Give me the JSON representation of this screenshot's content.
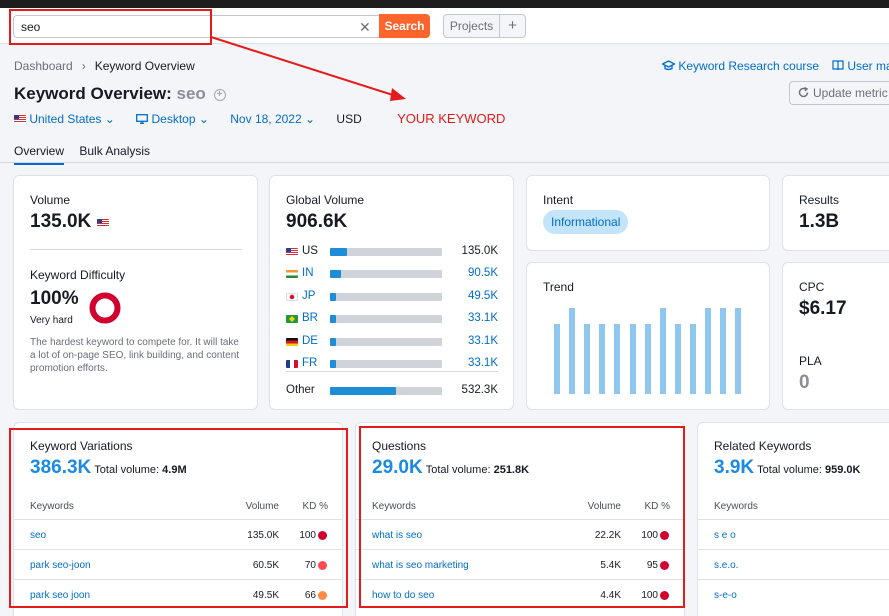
{
  "search": {
    "value": "seo",
    "button_label": "Search",
    "clear_symbol": "✕"
  },
  "header": {
    "projects_label": "Projects",
    "add_symbol": "+"
  },
  "breadcrumb": {
    "home": "Dashboard",
    "separator": "›",
    "current": "Keyword Overview"
  },
  "links": {
    "course": "Keyword Research course",
    "manual": "User ma"
  },
  "title": {
    "prefix": "Keyword Overview:",
    "keyword": "seo",
    "add_symbol": "+"
  },
  "update_button": "Update metric",
  "filters": {
    "country": "United States",
    "device": "Desktop",
    "date": "Nov 18, 2022",
    "currency": "USD",
    "annotation": "YOUR KEYWORD"
  },
  "tabs": [
    "Overview",
    "Bulk Analysis"
  ],
  "volume": {
    "label": "Volume",
    "value": "135.0K"
  },
  "difficulty": {
    "label": "Keyword Difficulty",
    "value": "100%",
    "level": "Very hard",
    "description": "The hardest keyword to compete for. It will take a lot of on-page SEO, link building, and content promotion efforts.",
    "percent": 100,
    "color": "#d1002f"
  },
  "global_volume": {
    "label": "Global Volume",
    "value": "906.6K",
    "countries": [
      {
        "code": "US",
        "flag": "flag-us",
        "value": "135.0K",
        "share": 0.15,
        "link": false
      },
      {
        "code": "IN",
        "flag": "flag-in",
        "value": "90.5K",
        "share": 0.1,
        "link": true
      },
      {
        "code": "JP",
        "flag": "flag-jp",
        "value": "49.5K",
        "share": 0.055,
        "link": true
      },
      {
        "code": "BR",
        "flag": "flag-br",
        "value": "33.1K",
        "share": 0.04,
        "link": true
      },
      {
        "code": "DE",
        "flag": "flag-de",
        "value": "33.1K",
        "share": 0.04,
        "link": true
      },
      {
        "code": "FR",
        "flag": "flag-fr",
        "value": "33.1K",
        "share": 0.04,
        "link": true
      }
    ],
    "other": {
      "label": "Other",
      "value": "532.3K",
      "share": 0.59
    }
  },
  "intent": {
    "label": "Intent",
    "value": "Informational"
  },
  "results": {
    "label": "Results",
    "value": "1.3B"
  },
  "trend": {
    "label": "Trend",
    "values": [
      0.7,
      0.86,
      0.7,
      0.7,
      0.7,
      0.7,
      0.7,
      0.86,
      0.7,
      0.7,
      0.86,
      0.86,
      0.86
    ]
  },
  "cpc": {
    "label": "CPC",
    "value": "$6.17"
  },
  "pla": {
    "label": "PLA",
    "value": "0"
  },
  "columns": {
    "keywords": "Keywords",
    "volume": "Volume",
    "kd": "KD %"
  },
  "total_volume_label": "Total volume:",
  "variations": {
    "title": "Keyword Variations",
    "count": "386.3K",
    "total_volume": "4.9M",
    "rows": [
      {
        "keyword": "seo",
        "volume": "135.0K",
        "kd": "100",
        "color": "#d1002f"
      },
      {
        "keyword": "park seo-joon",
        "volume": "60.5K",
        "kd": "70",
        "color": "#ff4953"
      },
      {
        "keyword": "park seo joon",
        "volume": "49.5K",
        "kd": "66",
        "color": "#ff8c43"
      }
    ]
  },
  "questions": {
    "title": "Questions",
    "count": "29.0K",
    "total_volume": "251.8K",
    "rows": [
      {
        "keyword": "what is seo",
        "volume": "22.2K",
        "kd": "100",
        "color": "#d1002f"
      },
      {
        "keyword": "what is seo marketing",
        "volume": "5.4K",
        "kd": "95",
        "color": "#d1002f"
      },
      {
        "keyword": "how to do seo",
        "volume": "4.4K",
        "kd": "100",
        "color": "#d1002f"
      }
    ]
  },
  "related": {
    "title": "Related Keywords",
    "count": "3.9K",
    "total_volume": "959.0K",
    "rows": [
      {
        "keyword": "s e o"
      },
      {
        "keyword": "s.e.o."
      },
      {
        "keyword": "s-e-o"
      }
    ]
  },
  "colors": {
    "accent": "#006dca",
    "search_button": "#ff642d",
    "annotation": "#e41b1b",
    "bar": "#1d8dd7",
    "trend": "#8fc7ee"
  }
}
